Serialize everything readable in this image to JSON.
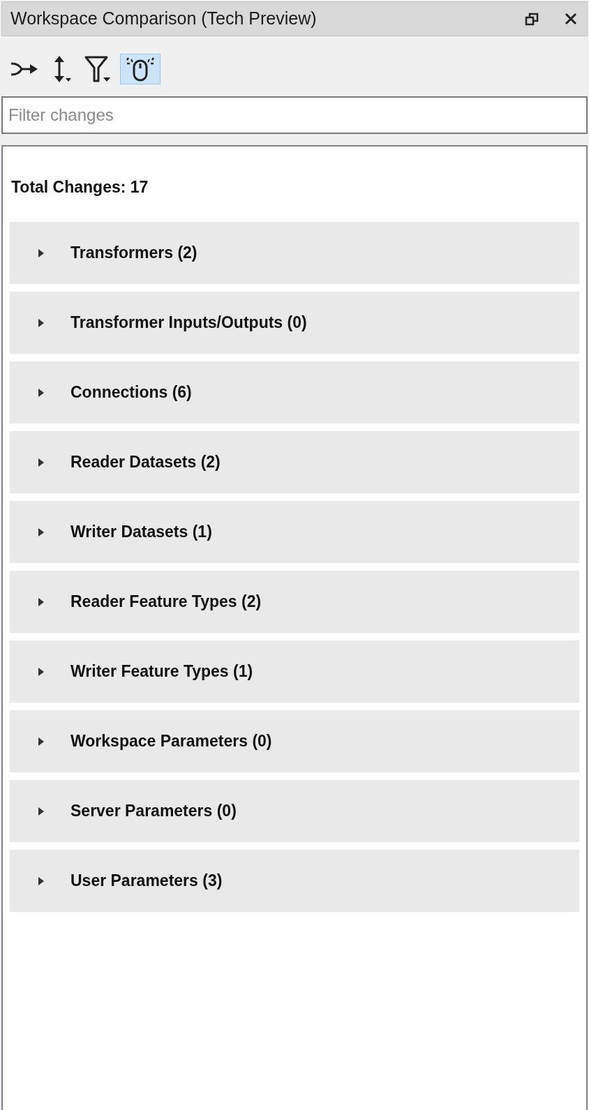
{
  "window": {
    "title": "Workspace Comparison (Tech Preview)"
  },
  "toolbar": [
    {
      "kind": "merge",
      "on": false
    },
    {
      "kind": "sort",
      "on": false
    },
    {
      "kind": "filter",
      "on": false
    },
    {
      "kind": "mouse",
      "on": true
    }
  ],
  "search": {
    "placeholder": "Filter changes"
  },
  "summary": {
    "total": "Total Changes: 17"
  },
  "sections": [
    {
      "label": "Transformers (2)",
      "expanded": false
    },
    {
      "label": "Transformer Inputs/Outputs (0)",
      "expanded": false
    },
    {
      "label": "Connections (6)",
      "expanded": false
    },
    {
      "label": "Reader Datasets (2)",
      "expanded": false
    },
    {
      "label": "Writer Datasets (1)",
      "expanded": false
    },
    {
      "label": "Reader Feature Types (2)",
      "expanded": false
    },
    {
      "label": "Writer Feature Types (1)",
      "expanded": false
    },
    {
      "label": "Workspace Parameters (0)",
      "expanded": false
    },
    {
      "label": "Server Parameters (0)",
      "expanded": false
    },
    {
      "label": "User Parameters (3)",
      "expanded": false
    }
  ]
}
